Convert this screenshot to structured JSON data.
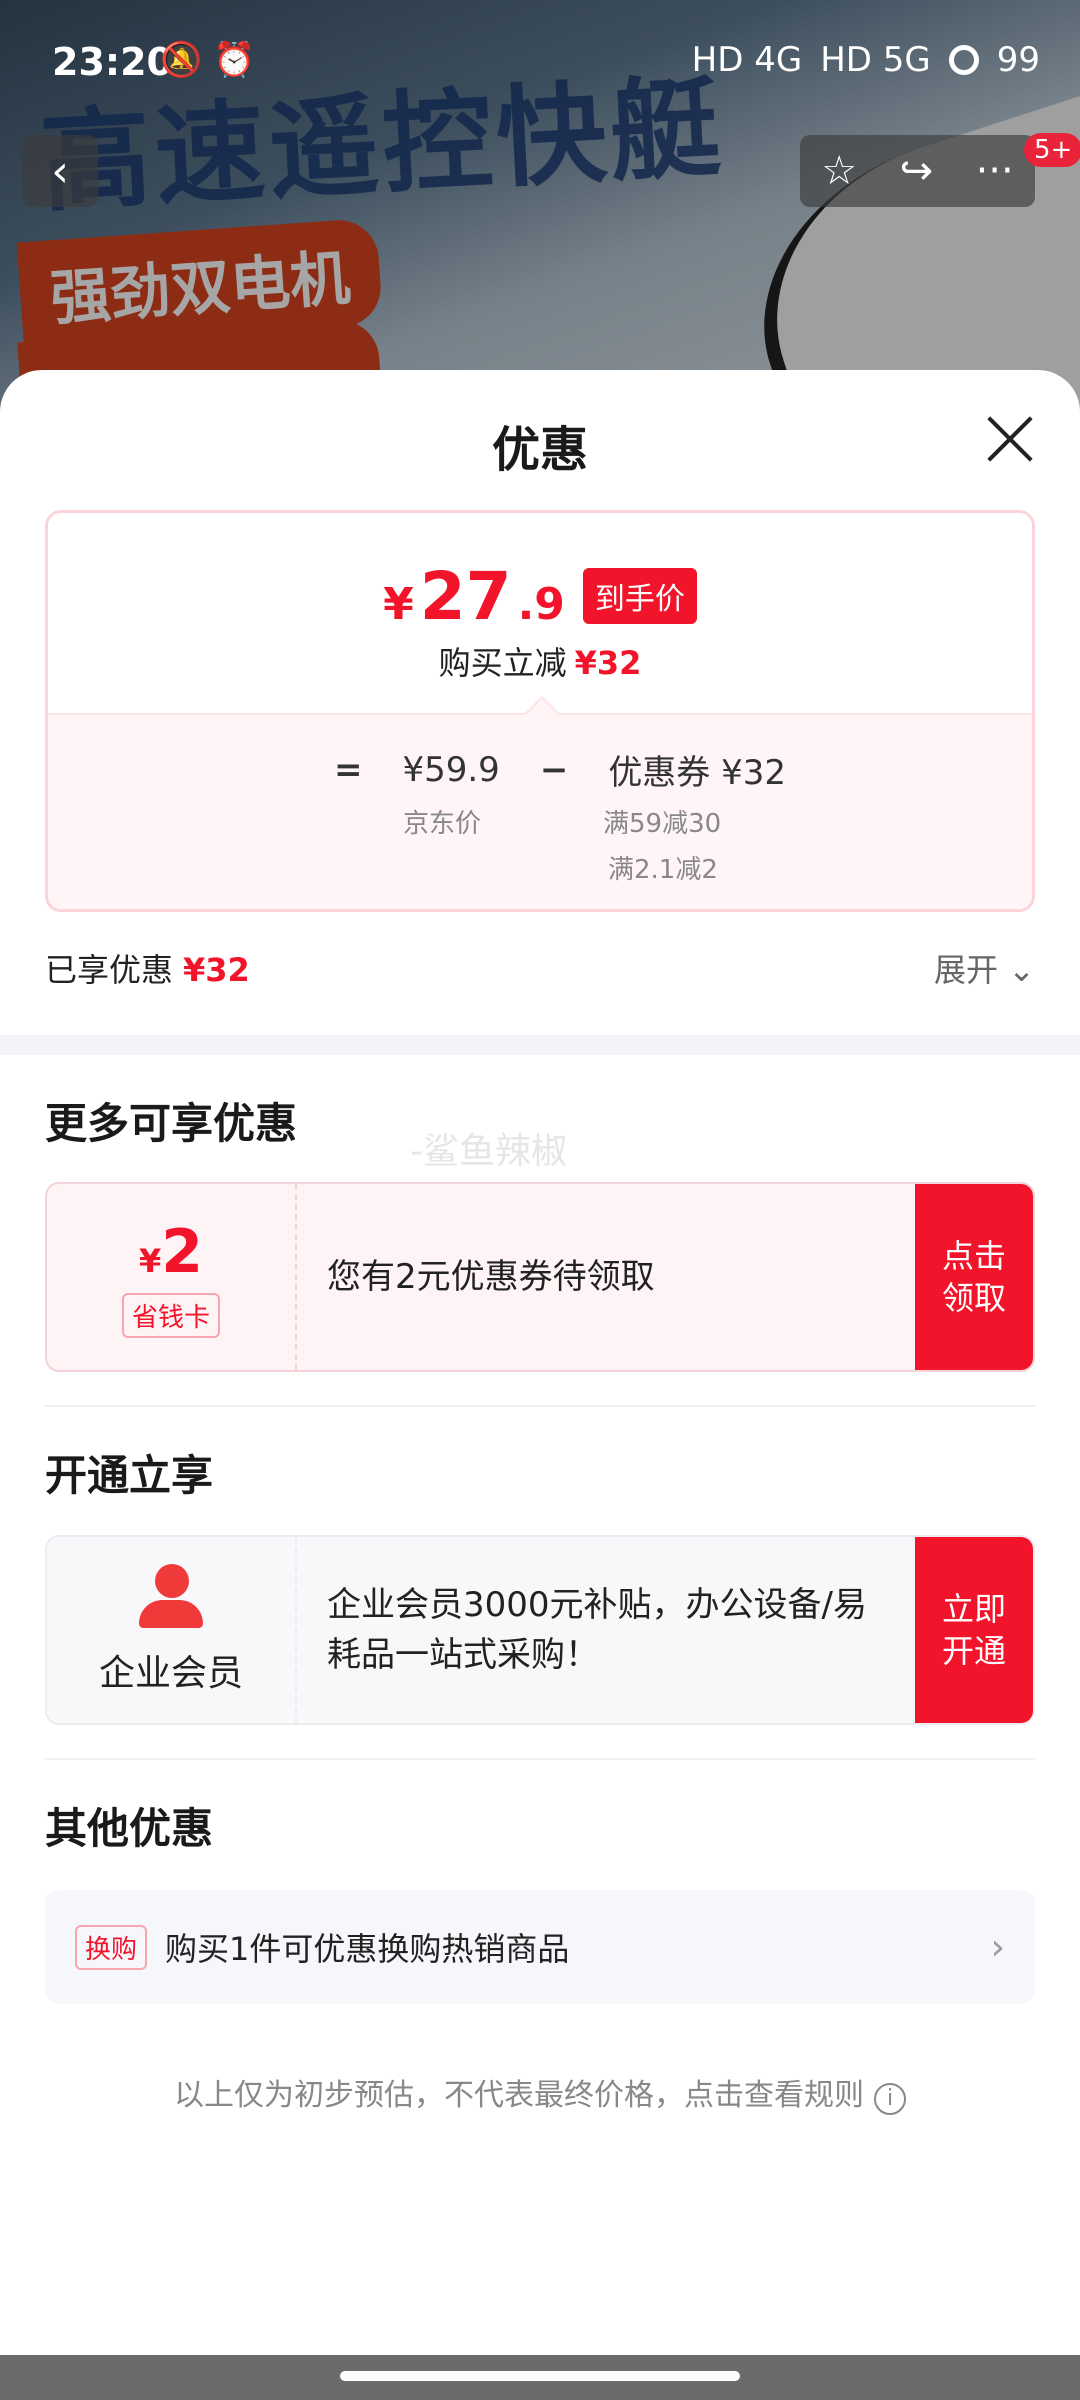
{
  "status_bar": {
    "time": "23:20",
    "left_icons": "🔕 ⏰",
    "net1": "HD 4G",
    "net2": "HD 5G",
    "battery": "99"
  },
  "banner": {
    "title": "高速遥控快艇",
    "tag": "强劲双电机"
  },
  "nav": {
    "back_glyph": "‹",
    "star_glyph": "☆",
    "share_glyph": "↪",
    "more_glyph": "···",
    "badge": "5+"
  },
  "sheet": {
    "title": "优惠"
  },
  "price_card": {
    "yen": "¥",
    "final_int": "27",
    "final_dec": ".9",
    "final_tag": "到手价",
    "sub_label": "购买立减",
    "sub_value": "¥32",
    "eq": "=",
    "minus": "−",
    "jd_price": "¥59.9",
    "jd_price_label": "京东价",
    "coupon_total": "优惠券 ¥32",
    "coupon_rule1": "满59减30",
    "coupon_rule2": "满2.1减2"
  },
  "enjoyed": {
    "label": "已享优惠",
    "value": "¥32",
    "expand": "展开 ⌄"
  },
  "more_offers": {
    "heading": "更多可享优惠",
    "watermark": "-鲨鱼辣椒",
    "card": {
      "currency": "¥",
      "amount": "2",
      "tag": "省钱卡",
      "text": "您有2元优惠券待领取",
      "button_line1": "点击",
      "button_line2": "领取"
    }
  },
  "membership": {
    "heading": "开通立享",
    "card": {
      "label": "企业会员",
      "text": "企业会员3000元补贴，办公设备/易耗品一站式采购！",
      "button_line1": "立即",
      "button_line2": "开通"
    }
  },
  "other_offers": {
    "heading": "其他优惠",
    "tag": "换购",
    "text": "购买1件可优惠换购热销商品",
    "chevron": "›"
  },
  "footnote": {
    "text": "以上仅为初步预估，不代表最终价格，点击查看规则",
    "icon": "i"
  },
  "colors": {
    "accent": "#f2142b",
    "member_icon": "#f03a3a"
  }
}
